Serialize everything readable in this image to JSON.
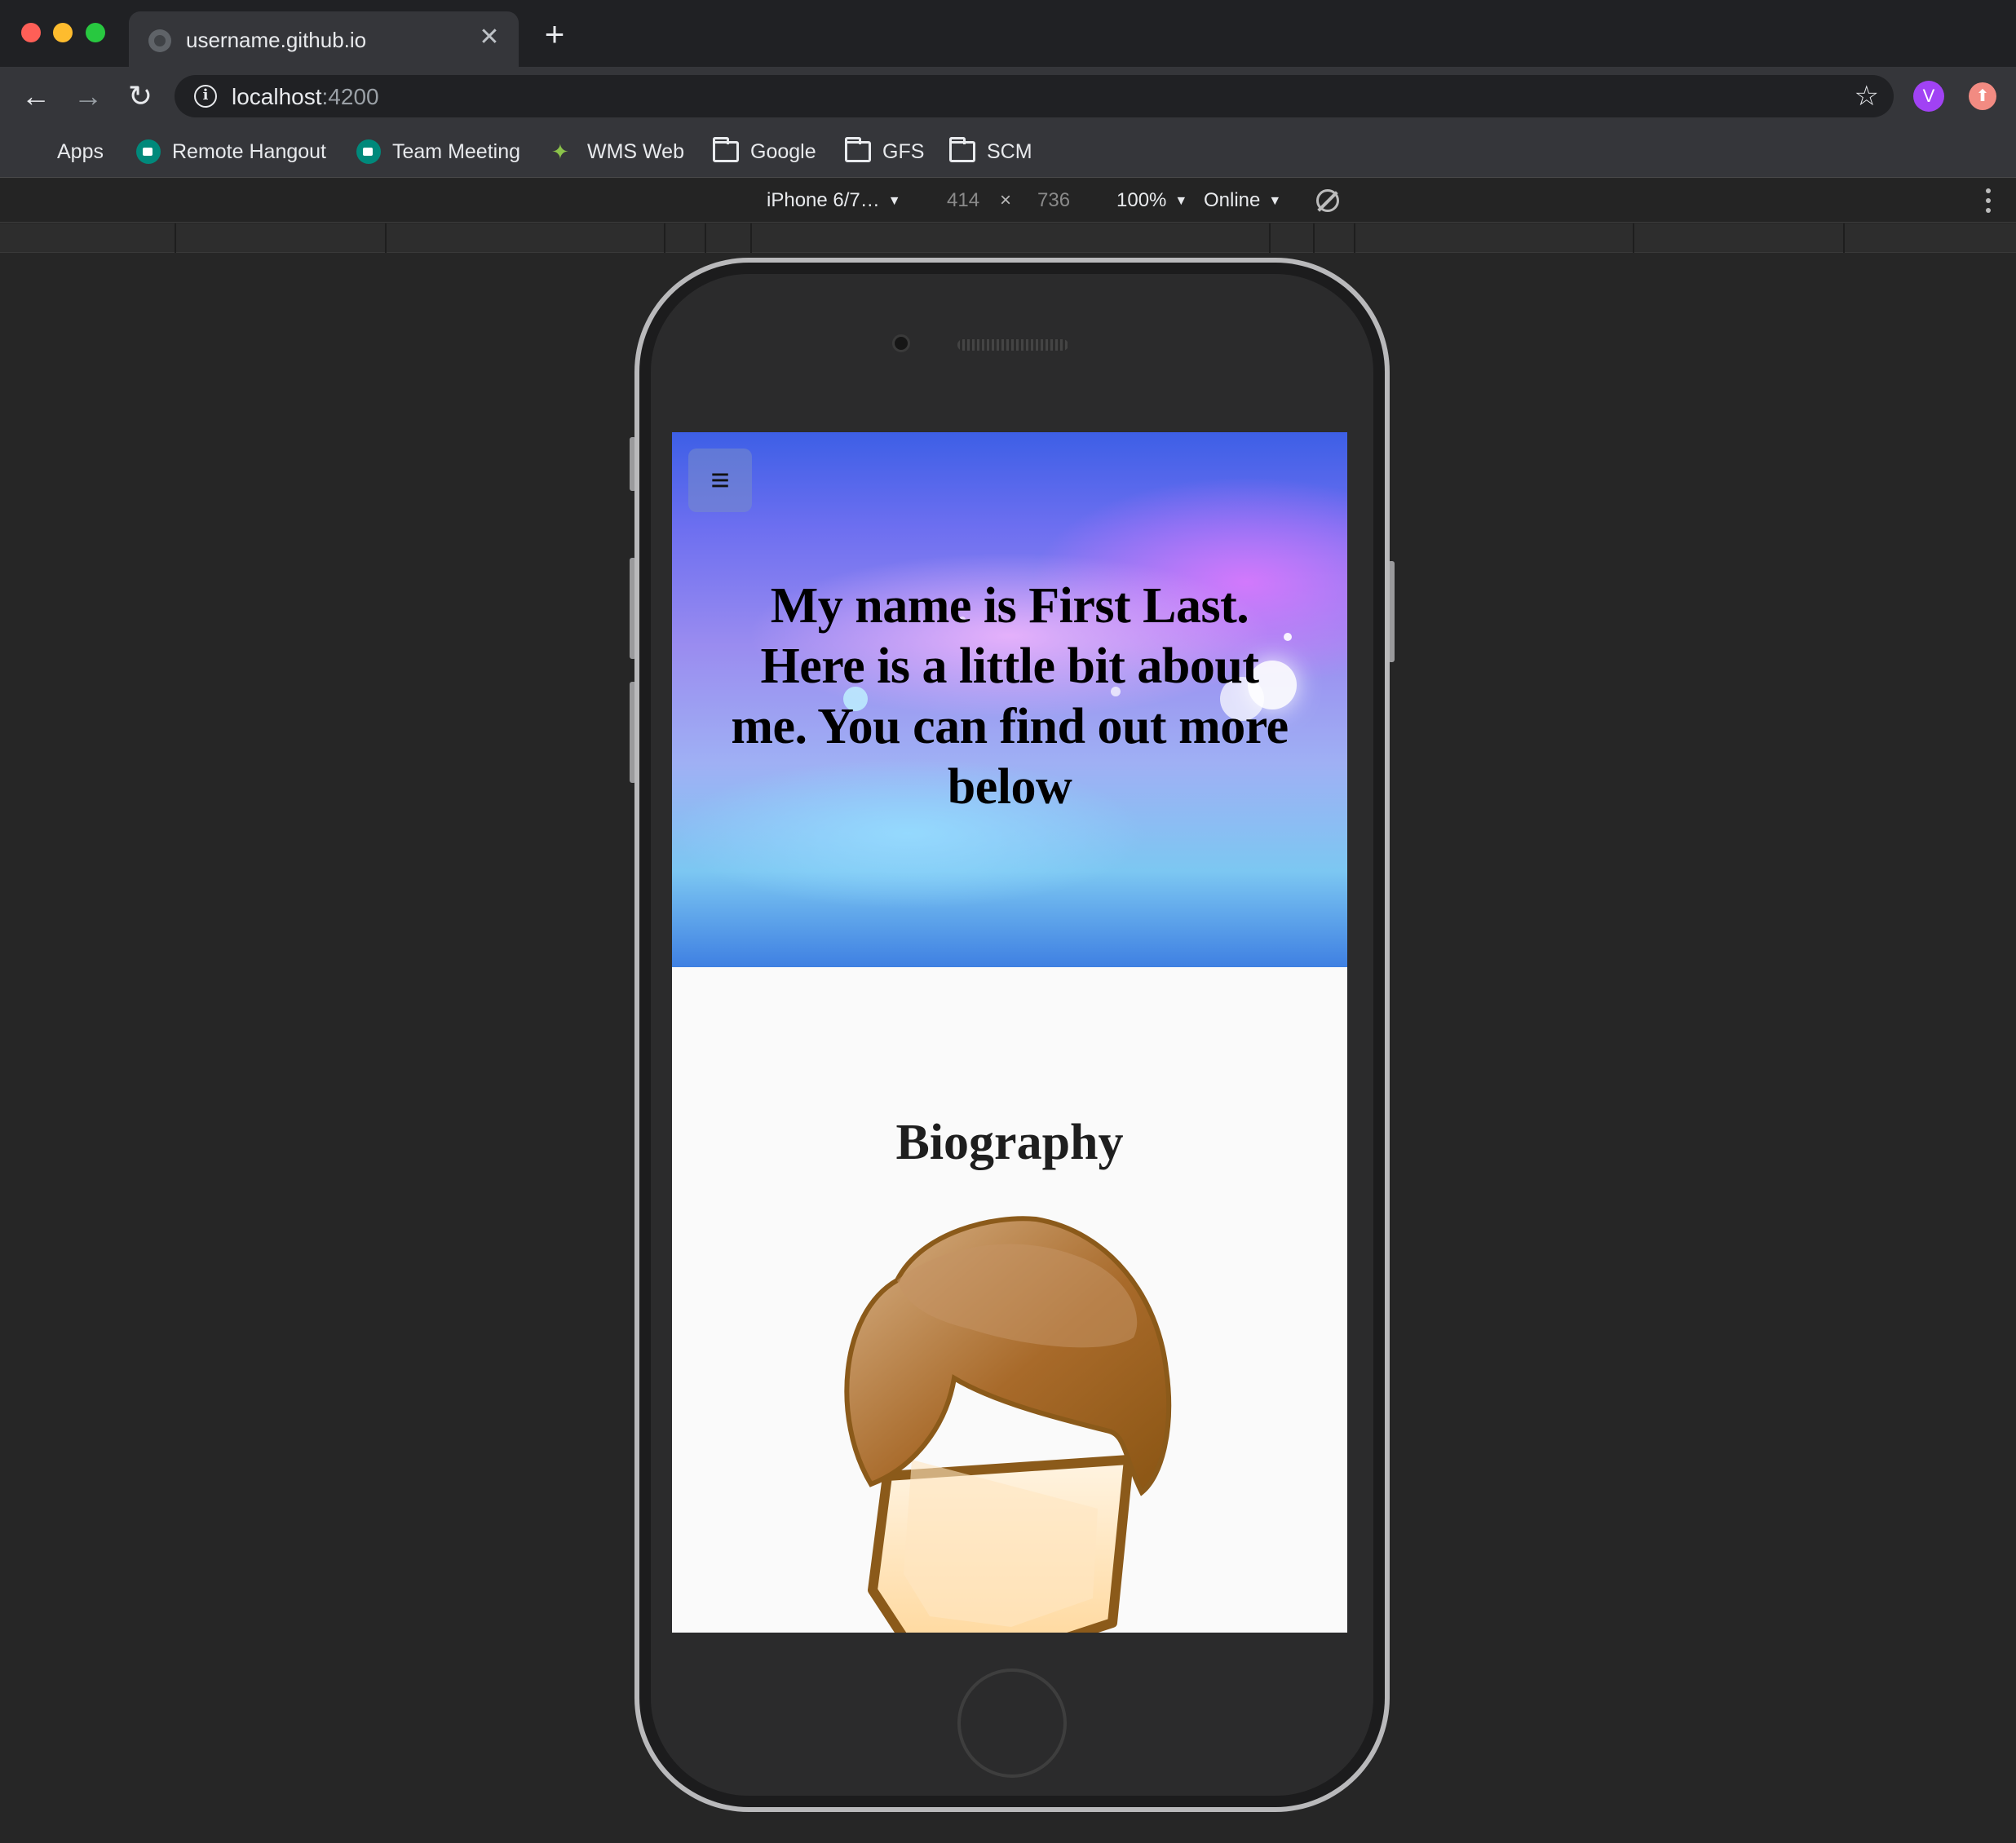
{
  "browser": {
    "tab_title": "username.github.io",
    "tab_close": "✕",
    "new_tab": "+",
    "nav": {
      "back": "←",
      "forward": "→",
      "reload": "↻"
    },
    "url_host": "localhost",
    "url_port": ":4200",
    "info_icon": "i",
    "star_icon": "☆",
    "profile_initial": "V",
    "extension_glyph": "⬆"
  },
  "bookmarks": [
    {
      "label": "Apps",
      "icon": "apps-grid-icon"
    },
    {
      "label": "Remote Hangout",
      "icon": "meet-icon"
    },
    {
      "label": "Team Meeting",
      "icon": "meet-icon"
    },
    {
      "label": "WMS Web",
      "icon": "wms-icon"
    },
    {
      "label": "Google",
      "icon": "folder-icon"
    },
    {
      "label": "GFS",
      "icon": "folder-icon"
    },
    {
      "label": "SCM",
      "icon": "folder-icon"
    }
  ],
  "apps_colors": [
    "#ea4335",
    "#fbbc04",
    "#34a853",
    "#4285f4",
    "#ea4335",
    "#fbbc04",
    "#34a853",
    "#4285f4",
    "#ea4335"
  ],
  "device_toolbar": {
    "device": "iPhone 6/7…",
    "width": "414",
    "times": "×",
    "height": "736",
    "zoom": "100%",
    "network": "Online",
    "caret": "▼"
  },
  "page": {
    "menu_icon": "≡",
    "hero_text": "My name is First Last. Here is a little bit about me. You can find out more below",
    "bio_heading": "Biography"
  },
  "colors": {
    "hero_gradient_top": "#3d5fe6",
    "hero_gradient_mid": "#9a8cf0",
    "hero_gradient_bottom": "#3f80e2",
    "hair": "#8b5a1a",
    "skin": "#ffe2b8"
  }
}
